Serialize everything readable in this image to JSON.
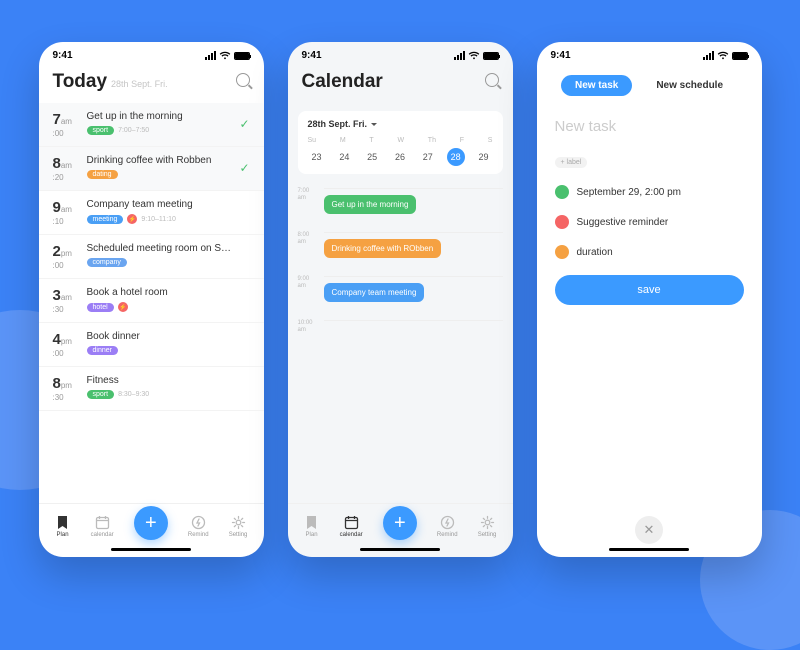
{
  "status_time": "9:41",
  "today": {
    "title": "Today",
    "subtitle": "28th Sept. Fri.",
    "tasks": [
      {
        "h": "7",
        "ap": "am",
        "m": ":00",
        "title": "Get up in the morning",
        "tag": "sport",
        "tagClass": "tag-green",
        "range": "7:00–7:50",
        "done": true
      },
      {
        "h": "8",
        "ap": "am",
        "m": ":20",
        "title": "Drinking coffee with Robben",
        "tag": "dating",
        "tagClass": "tag-orange",
        "done": true
      },
      {
        "h": "9",
        "ap": "am",
        "m": ":10",
        "title": "Company team meeting",
        "tag": "meeting",
        "tagClass": "tag-blue",
        "range": "9:10–11:10",
        "alert": true
      },
      {
        "h": "2",
        "ap": "pm",
        "m": ":00",
        "title": "Scheduled meeting room on S…",
        "tag": "company",
        "tagClass": "tag-comp"
      },
      {
        "h": "3",
        "ap": "am",
        "m": ":30",
        "title": "Book a hotel room",
        "tag": "hotel",
        "tagClass": "tag-purple",
        "alert": true
      },
      {
        "h": "4",
        "ap": "pm",
        "m": ":00",
        "title": "Book dinner",
        "tag": "dinner",
        "tagClass": "tag-purple"
      },
      {
        "h": "8",
        "ap": "pm",
        "m": ":30",
        "title": "Fitness",
        "tag": "sport",
        "tagClass": "tag-green",
        "range": "8:30–9:30"
      }
    ],
    "nav": [
      "Plan",
      "calendar",
      "",
      "Remind",
      "Setting"
    ]
  },
  "calendar": {
    "title": "Calendar",
    "date_label": "28th Sept. Fri.",
    "week": [
      "Su",
      "M",
      "T",
      "W",
      "Th",
      "F",
      "S"
    ],
    "days": [
      "23",
      "24",
      "25",
      "26",
      "27",
      "28",
      "29"
    ],
    "selected_idx": 5,
    "slots": [
      "7:00 am",
      "8:00 am",
      "9:00 am",
      "10:00 am"
    ],
    "events": [
      {
        "slot": 0,
        "text": "Get up in the morning",
        "cls": "ev-green"
      },
      {
        "slot": 1,
        "text": "Drinking coffee with RObben",
        "cls": "ev-orange"
      },
      {
        "slot": 2,
        "text": "Company team meeting",
        "cls": "ev-blue"
      }
    ],
    "nav": [
      "Plan",
      "calendar",
      "",
      "Remind",
      "Setting"
    ]
  },
  "newtask": {
    "tab_active": "New task",
    "tab_inactive": "New schedule",
    "input_placeholder": "New task",
    "label_chip": "+ label",
    "opts": [
      {
        "ic": "ic-g",
        "text": "September 29, 2:00 pm"
      },
      {
        "ic": "ic-r",
        "text": "Suggestive reminder"
      },
      {
        "ic": "ic-o",
        "text": "duration"
      }
    ],
    "save": "save"
  }
}
